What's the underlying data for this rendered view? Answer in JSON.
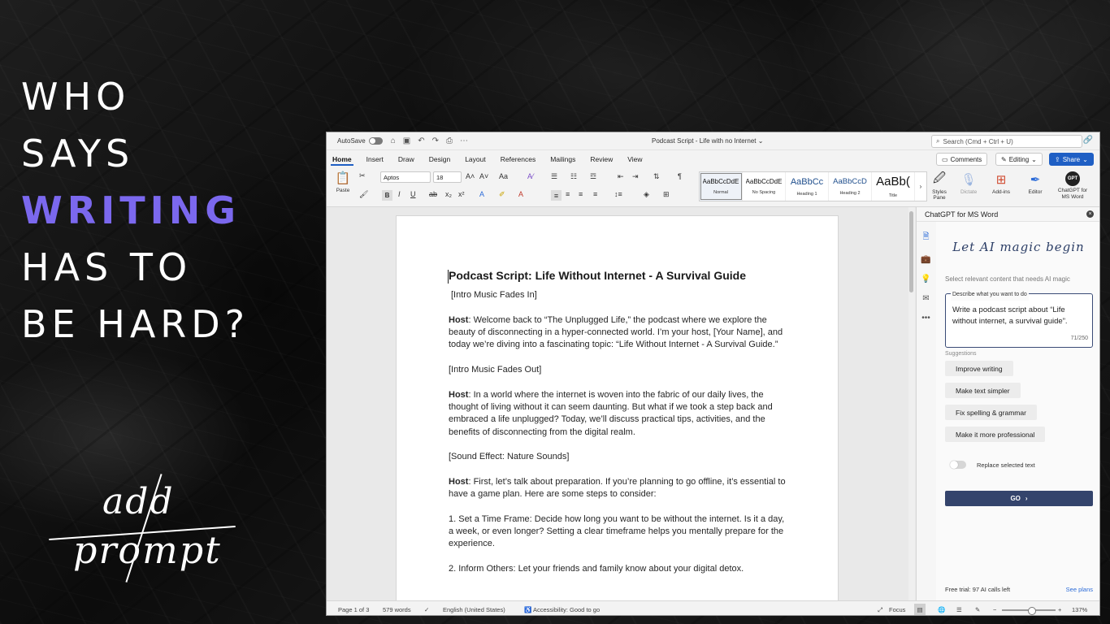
{
  "headline": {
    "line1": "WHO",
    "line2": "SAYS",
    "line3": "WRITING",
    "line4": "HAS TO",
    "line5": "BE HARD?",
    "accent_color": "#7b68ee"
  },
  "script_caption": {
    "line1": "add",
    "line2": "prompt"
  },
  "word": {
    "autosave_label": "AutoSave",
    "doc_title": "Podcast Script - Life with no Internet",
    "search_placeholder": "Search (Cmd + Ctrl + U)",
    "tabs": [
      "Home",
      "Insert",
      "Draw",
      "Design",
      "Layout",
      "References",
      "Mailings",
      "Review",
      "View"
    ],
    "comments_label": "Comments",
    "editing_label": "Editing",
    "share_label": "Share",
    "ribbon": {
      "paste_label": "Paste",
      "font_name": "Aptos",
      "font_size": "18",
      "styles": [
        {
          "preview": "AaBbCcDdE",
          "name": "Normal"
        },
        {
          "preview": "AaBbCcDdE",
          "name": "No Spacing"
        },
        {
          "preview": "AaBbCc",
          "name": "Heading 1"
        },
        {
          "preview": "AaBbCcD",
          "name": "Heading 2"
        },
        {
          "preview": "AaBb(",
          "name": "Title"
        }
      ],
      "styles_pane_label": "Styles Pane",
      "dictate_label": "Dictate",
      "addins_label": "Add-ins",
      "editor_label": "Editor",
      "gpt_label": "ChatGPT for MS Word",
      "gpt_icon_text": "GPT"
    },
    "document": {
      "title": "Podcast Script: Life Without Internet - A Survival Guide",
      "p1": "[Intro Music Fades In]",
      "p2_speaker": "Host",
      "p2_text": ": Welcome back to “The Unplugged Life,” the podcast where we explore the beauty of disconnecting in a hyper-connected world. I’m your host, [Your Name], and today we’re diving into a fascinating topic: “Life Without Internet - A Survival Guide.”",
      "p3": "[Intro Music Fades Out]",
      "p4_speaker": "Host",
      "p4_text": ": In a world where the internet is woven into the fabric of our daily lives, the thought of living without it can seem daunting. But what if we took a step back and embraced a life unplugged? Today, we’ll discuss practical tips, activities, and the benefits of disconnecting from the digital realm.",
      "p5": "[Sound Effect: Nature Sounds]",
      "p6_speaker": "Host",
      "p6_text": ": First, let’s talk about preparation. If you’re planning to go offline, it’s essential to have a game plan. Here are some steps to consider:",
      "p7": "1. Set a Time Frame: Decide how long you want to be without the internet. Is it a day, a week, or even longer? Setting a clear timeframe helps you mentally prepare for the experience.",
      "p8": "2. Inform Others: Let your friends and family know about your digital detox."
    },
    "pane": {
      "title": "ChatGPT for MS Word",
      "heading": "Let AI magic begin",
      "subtitle": "Select relevant content that needs AI magic",
      "prompt_label": "Describe what you want to do",
      "prompt_value": "Write a podcast script about “Life without internet, a survival guide”.",
      "char_count": "71/250",
      "suggestions_label": "Suggestions",
      "suggestions": [
        "Improve writing",
        "Make text simpler",
        "Fix spelling & grammar",
        "Make it more professional"
      ],
      "replace_label": "Replace selected text",
      "go_label": "GO",
      "trial_text": "Free trial: 97 AI calls left",
      "see_plans": "See plans"
    },
    "status": {
      "page": "Page 1 of 3",
      "words": "579 words",
      "language": "English (United States)",
      "accessibility": "Accessibility: Good to go",
      "focus": "Focus",
      "zoom": "137%"
    }
  }
}
